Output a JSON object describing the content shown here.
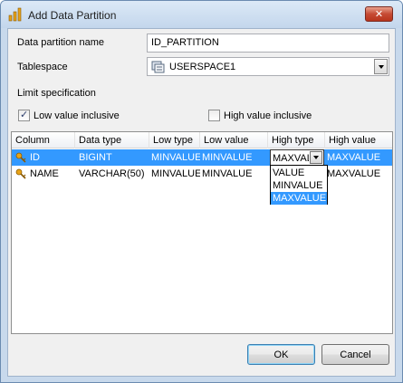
{
  "window": {
    "title": "Add Data Partition",
    "close_symbol": "✕"
  },
  "fields": {
    "partition_name_label": "Data partition name",
    "partition_name_value": "ID_PARTITION",
    "tablespace_label": "Tablespace",
    "tablespace_value": "USERSPACE1"
  },
  "limit": {
    "label": "Limit specification",
    "low_inclusive_label": "Low value inclusive",
    "low_inclusive_checked": true,
    "high_inclusive_label": "High value inclusive",
    "high_inclusive_checked": false
  },
  "grid": {
    "headers": [
      "Column",
      "Data type",
      "Low type",
      "Low value",
      "High type",
      "High value"
    ],
    "rows": [
      {
        "column": "ID",
        "data_type": "BIGINT",
        "low_type": "MINVALUE",
        "low_value": "MINVALUE",
        "high_type": "MAXVALUE",
        "high_value": "MAXVALUE",
        "selected": true
      },
      {
        "column": "NAME",
        "data_type": "VARCHAR(50)",
        "low_type": "MINVALUE",
        "low_value": "MINVALUE",
        "high_type": "",
        "high_value": "MAXVALUE",
        "selected": false
      }
    ],
    "dropdown_options": [
      "VALUE",
      "MINVALUE",
      "MAXVALUE"
    ],
    "dropdown_selected": "MAXVALUE"
  },
  "buttons": {
    "ok_label": "OK",
    "cancel_label": "Cancel"
  }
}
